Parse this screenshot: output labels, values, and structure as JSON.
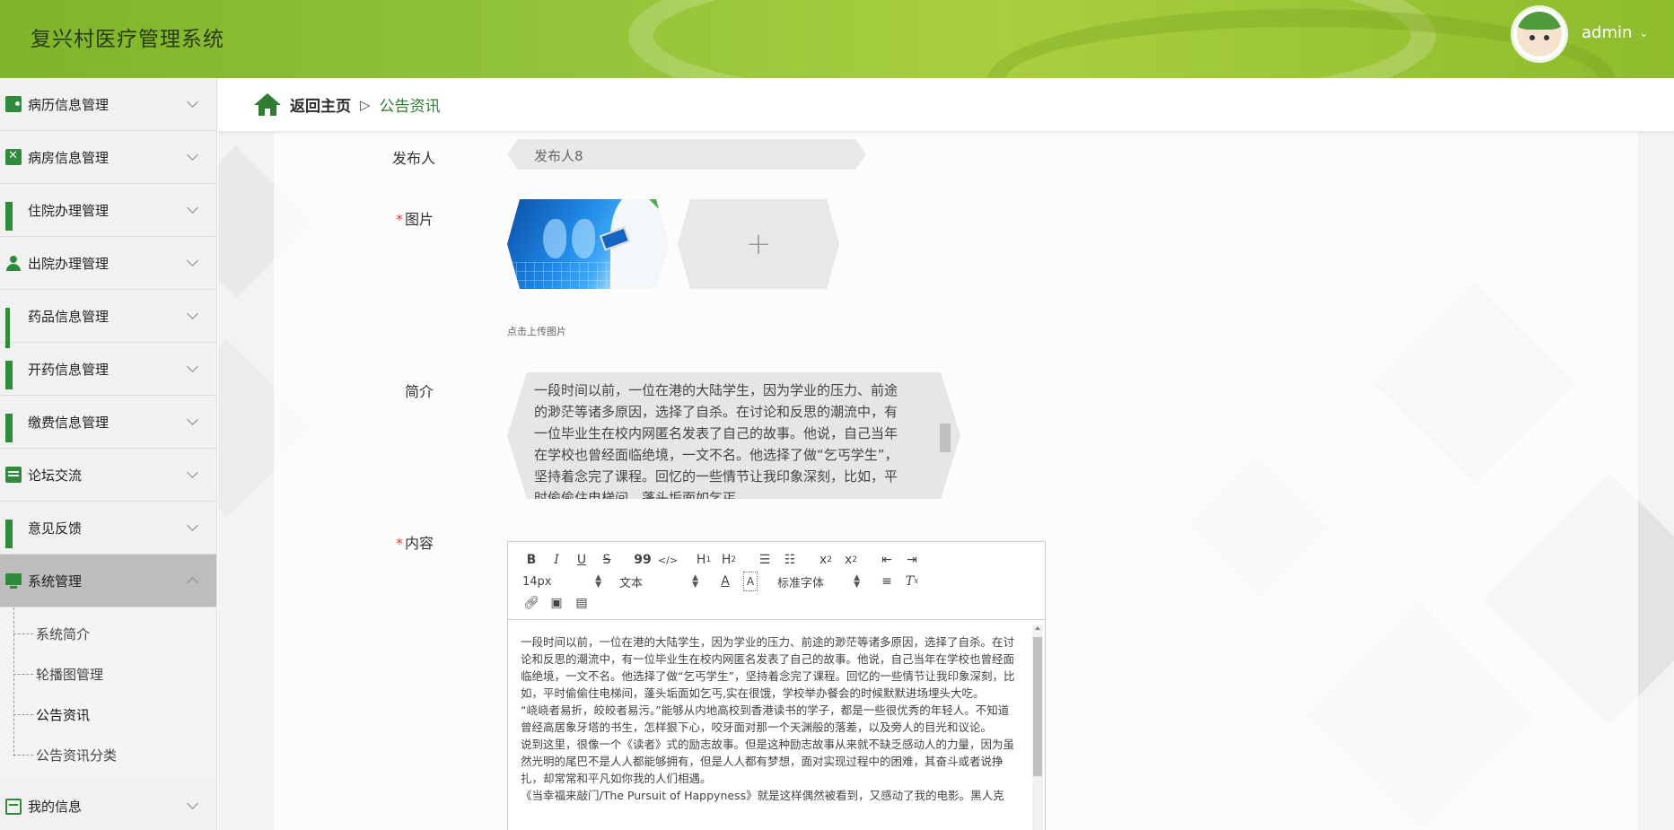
{
  "header": {
    "title": "复兴村医疗管理系统",
    "username": "admin"
  },
  "sidebar": {
    "items": [
      {
        "label": "病历信息管理",
        "icon": "wallet-icon"
      },
      {
        "label": "病房信息管理",
        "icon": "clipboard-x-icon"
      },
      {
        "label": "住院办理管理",
        "icon": "grid-icon"
      },
      {
        "label": "出院办理管理",
        "icon": "person-icon"
      },
      {
        "label": "药品信息管理",
        "icon": "grid9-icon"
      },
      {
        "label": "开药信息管理",
        "icon": "grid-icon"
      },
      {
        "label": "缴费信息管理",
        "icon": "grid-icon"
      },
      {
        "label": "论坛交流",
        "icon": "clipboard-icon"
      },
      {
        "label": "意见反馈",
        "icon": "grid-icon"
      },
      {
        "label": "系统管理",
        "icon": "monitor-icon"
      },
      {
        "label": "我的信息",
        "icon": "card-icon"
      }
    ],
    "system_sub": [
      "系统简介",
      "轮播图管理",
      "公告资讯",
      "公告资讯分类"
    ]
  },
  "breadcrumb": {
    "home": "返回主页",
    "separator": "▷",
    "current": "公告资讯"
  },
  "form": {
    "publisher_label": "发布人",
    "publisher_value": "发布人8",
    "image_label": "图片",
    "upload_plus": "+",
    "upload_hint": "点击上传图片",
    "intro_label": "简介",
    "intro_text": "一段时间以前，一位在港的大陆学生，因为学业的压力、前途的渺茫等诸多原因，选择了自杀。在讨论和反思的潮流中，有一位毕业生在校内网匿名发表了自己的故事。他说，自己当年在学校也曾经面临绝境，一文不名。他选择了做“乞丐学生”，坚持着念完了课程。回忆的一些情节让我印象深刻，比如，平时偷偷住电梯间，蓬头垢面如乞丐",
    "content_label": "内容",
    "required_mark": "*"
  },
  "editor": {
    "toolbar_row1": [
      "B",
      "I",
      "U",
      "S",
      "99",
      "</>",
      "H1",
      "H2",
      "ol",
      "ul",
      "x2",
      "x²",
      "outdent",
      "indent"
    ],
    "font_size": "14px",
    "block_type": "文本",
    "font_family": "标准字体",
    "paragraphs": [
      "一段时间以前，一位在港的大陆学生，因为学业的压力、前途的渺茫等诸多原因，选择了自杀。在讨论和反思的潮流中，有一位毕业生在校内网匿名发表了自己的故事。他说，自己当年在学校也曾经面临绝境，一文不名。他选择了做“乞丐学生”，坚持着念完了课程。回忆的一些情节让我印象深刻，比如，平时偷偷住电梯间，蓬头垢面如乞丐,实在很饿，学校举办餐会的时候默默进场埋头大吃。",
      "“峣峣者易折，皎皎者易污。”能够从内地高校到香港读书的学子，都是一些很优秀的年轻人。不知道曾经高居象牙塔的书生，怎样狠下心，咬牙面对那一个天渊般的落差，以及旁人的目光和议论。",
      "说到这里，很像一个《读者》式的励志故事。但是这种励志故事从来就不缺乏感动人的力量，因为虽然光明的尾巴不是人人都能够拥有，但是人人都有梦想，面对实现过程中的困难，其奋斗或者说挣扎，却常常和平凡如你我的人们相遇。",
      "《当幸福来敲门/The Pursuit of Happyness》就是这样偶然被看到，又感动了我的电影。黑人克"
    ]
  },
  "colors": {
    "header_green": "#8dbc2c",
    "icon_green": "#2f8a3b",
    "active_menu": "#bdbdbd",
    "breadcrumb_green": "#2e7d32",
    "required_red": "#e53935"
  }
}
